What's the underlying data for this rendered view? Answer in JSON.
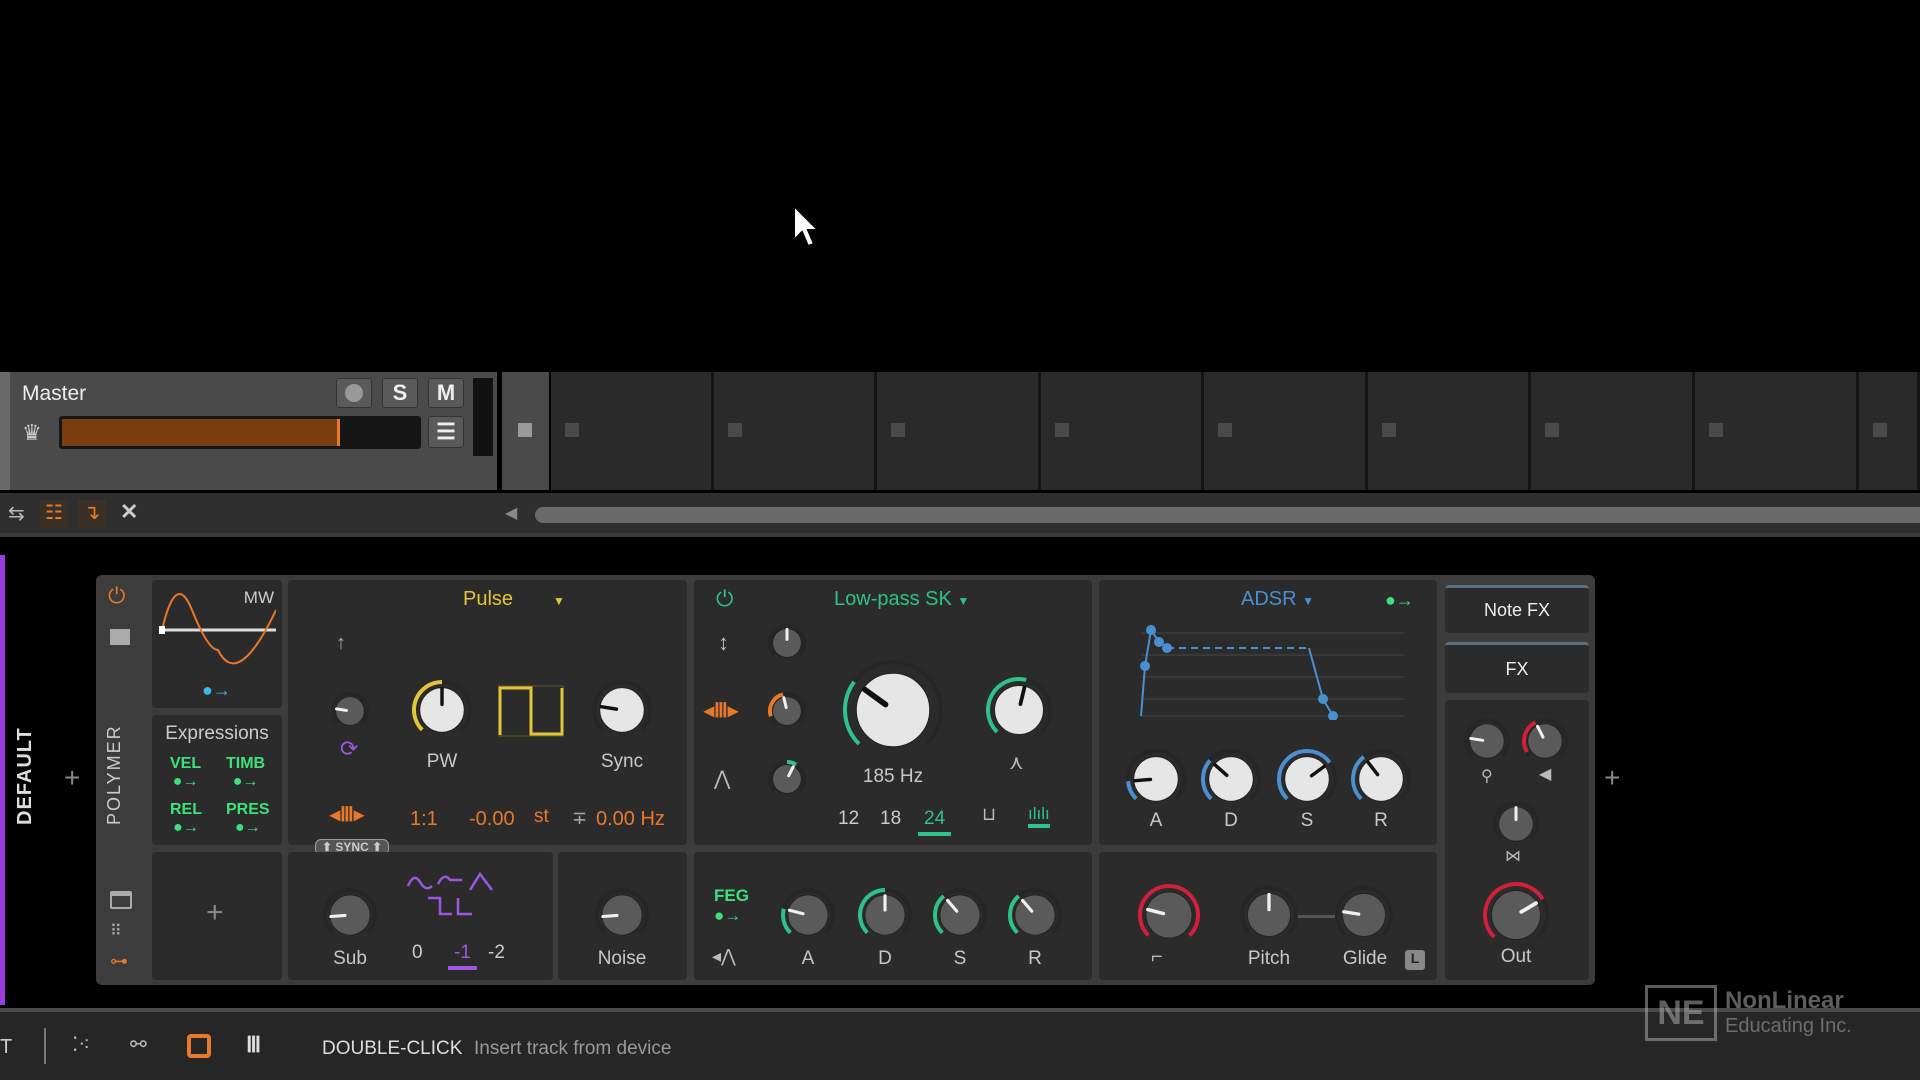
{
  "track": {
    "name": "Master",
    "record_label": "",
    "solo_label": "S",
    "mute_label": "M",
    "volume_level": 0.78
  },
  "clip_slots": 10,
  "device_chain": {
    "layer_label": "DEFAULT",
    "device_name": "POLYMER"
  },
  "lfo": {
    "label": "MW"
  },
  "expressions": {
    "title": "Expressions",
    "items": [
      "VEL",
      "TIMB",
      "REL",
      "PRES"
    ]
  },
  "oscillator": {
    "type": "Pulse",
    "pw_label": "PW",
    "sync_label": "Sync",
    "ratio": "1:1",
    "semitones": "-0.00",
    "semitone_unit": "st",
    "fine": "0.00 Hz",
    "sync_badge": "SYNC",
    "knobs": [
      {
        "value": 0.2,
        "face": "grey"
      },
      {
        "value": 0.5,
        "face": "white",
        "color": "#e2c53a",
        "arc": [
          0,
          0.5
        ]
      },
      {
        "value": 0.2,
        "face": "white"
      }
    ]
  },
  "sub": {
    "label": "Sub",
    "octaves": [
      "0",
      "-1",
      "-2"
    ],
    "selected_octave": "-1",
    "knob": {
      "value": 0.15,
      "face": "grey"
    }
  },
  "noise": {
    "label": "Noise",
    "knob": {
      "value": 0.15,
      "face": "grey"
    }
  },
  "filter": {
    "type": "Low-pass SK",
    "cutoff": "185 Hz",
    "slopes": [
      "12",
      "18",
      "24"
    ],
    "selected_slope": "24",
    "knobs": [
      {
        "value": 0.5,
        "face": "grey"
      },
      {
        "value": 0.45,
        "face": "grey",
        "color": "#e8782a",
        "arc": [
          0.1,
          0.45
        ]
      },
      {
        "value": 0.6,
        "face": "grey",
        "color": "#2ec28a",
        "arc": [
          0.5,
          0.62
        ]
      },
      {
        "value": 0.3,
        "face": "white",
        "color": "#2ec28a",
        "arc": [
          0,
          0.3
        ]
      },
      {
        "value": 0.55,
        "face": "white",
        "color": "#2ec28a",
        "arc": [
          0,
          0.55
        ]
      }
    ]
  },
  "feg": {
    "label": "FEG",
    "knob_labels": [
      "A",
      "D",
      "S",
      "R"
    ],
    "knobs": [
      {
        "value": 0.22,
        "face": "grey",
        "color": "#2ec28a",
        "arc": [
          0,
          0.22
        ]
      },
      {
        "value": 0.5,
        "face": "grey",
        "color": "#2ec28a",
        "arc": [
          0,
          0.5
        ]
      },
      {
        "value": 0.35,
        "face": "grey",
        "color": "#2ec28a",
        "arc": [
          0,
          0.35
        ]
      },
      {
        "value": 0.35,
        "face": "grey",
        "color": "#2ec28a",
        "arc": [
          0,
          0.35
        ]
      }
    ]
  },
  "envelope": {
    "type": "ADSR",
    "knob_labels": [
      "A",
      "D",
      "S",
      "R"
    ],
    "knobs": [
      {
        "value": 0.15,
        "face": "white",
        "color": "#4a90d0",
        "arc": [
          0,
          0.15
        ]
      },
      {
        "value": 0.32,
        "face": "white",
        "color": "#4a90d0",
        "arc": [
          0,
          0.32
        ]
      },
      {
        "value": 0.7,
        "face": "white",
        "color": "#4a90d0",
        "arc": [
          0,
          0.7
        ]
      },
      {
        "value": 0.36,
        "face": "white",
        "color": "#4a90d0",
        "arc": [
          0,
          0.36
        ]
      }
    ]
  },
  "voice": {
    "pitch_label": "Pitch",
    "glide_label": "Glide",
    "glide_badge": "L",
    "knobs": [
      {
        "value": 0.22,
        "face": "grey",
        "color": "#d0203a",
        "arc": [
          0,
          1
        ]
      },
      {
        "value": 0.5,
        "face": "grey"
      },
      {
        "value": 0.2,
        "face": "grey"
      }
    ]
  },
  "output": {
    "note_fx_label": "Note FX",
    "fx_label": "FX",
    "out_label": "Out",
    "knobs": [
      {
        "value": 0.2,
        "face": "grey"
      },
      {
        "value": 0.4,
        "face": "grey",
        "color": "#d0203a",
        "arc": [
          0.05,
          0.4
        ]
      },
      {
        "value": 0.5,
        "face": "grey"
      },
      {
        "value": 0.72,
        "face": "grey",
        "color": "#d0203a",
        "arc": [
          0,
          0.72
        ]
      }
    ]
  },
  "status_bar": {
    "left_letter": "T",
    "hint_key": "DOUBLE-CLICK",
    "hint_text": "Insert track from device"
  },
  "watermark": {
    "line1": "NonLinear",
    "line2": "Educating Inc."
  },
  "colors": {
    "accent_orange": "#e8782a",
    "osc_yellow": "#e2c53a",
    "filter_green": "#2ec28a",
    "env_blue": "#4a90d0",
    "out_red": "#d0203a",
    "sub_purple": "#a055e0"
  }
}
